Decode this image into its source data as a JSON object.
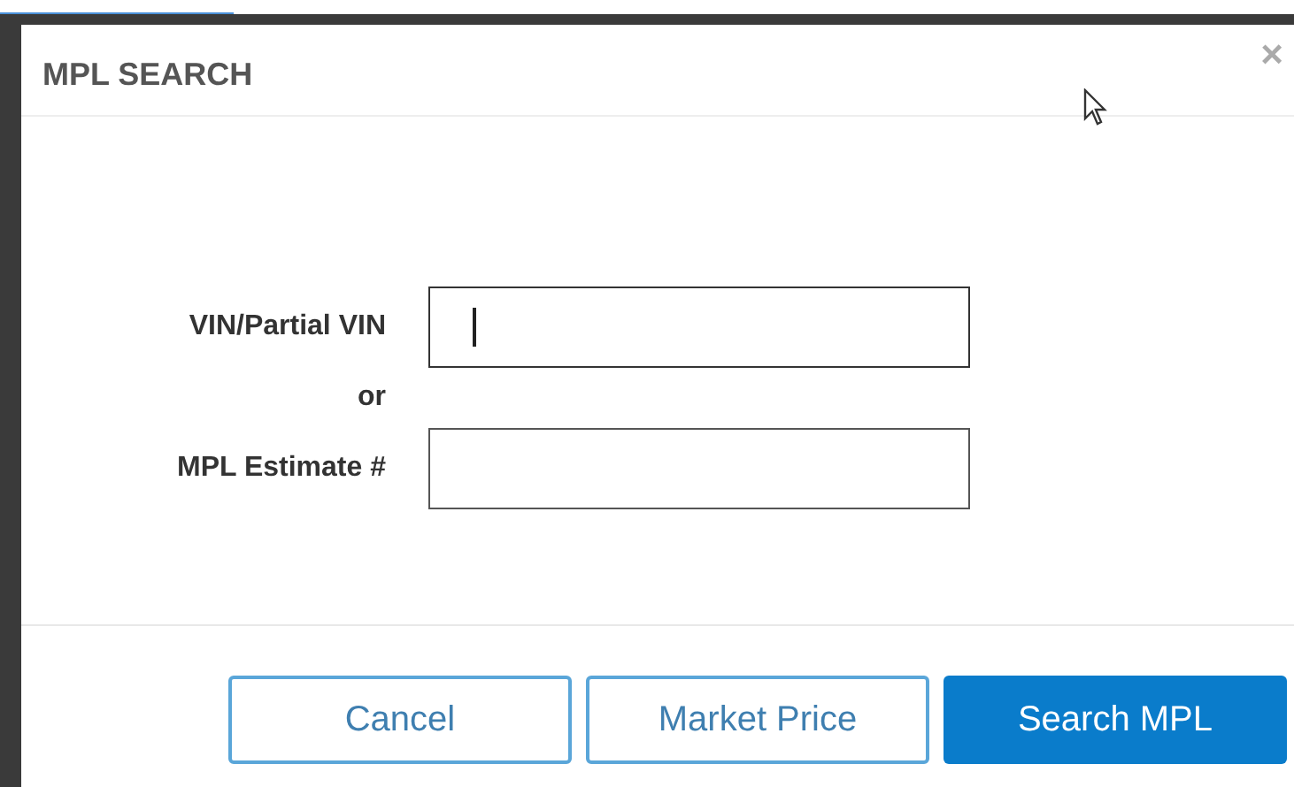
{
  "dialog": {
    "title": "MPL SEARCH",
    "close": "×"
  },
  "fields": [
    {
      "kind": "input",
      "label": "VIN/Partial VIN",
      "focused": true
    },
    {
      "kind": "separator",
      "label": "or"
    },
    {
      "kind": "input",
      "label": "MPL Estimate #",
      "focused": false
    }
  ],
  "buttons": [
    {
      "label": "Cancel",
      "kind": "secondary"
    },
    {
      "label": "Market Price",
      "kind": "secondary"
    },
    {
      "label": "Search MPL",
      "kind": "primary"
    }
  ]
}
